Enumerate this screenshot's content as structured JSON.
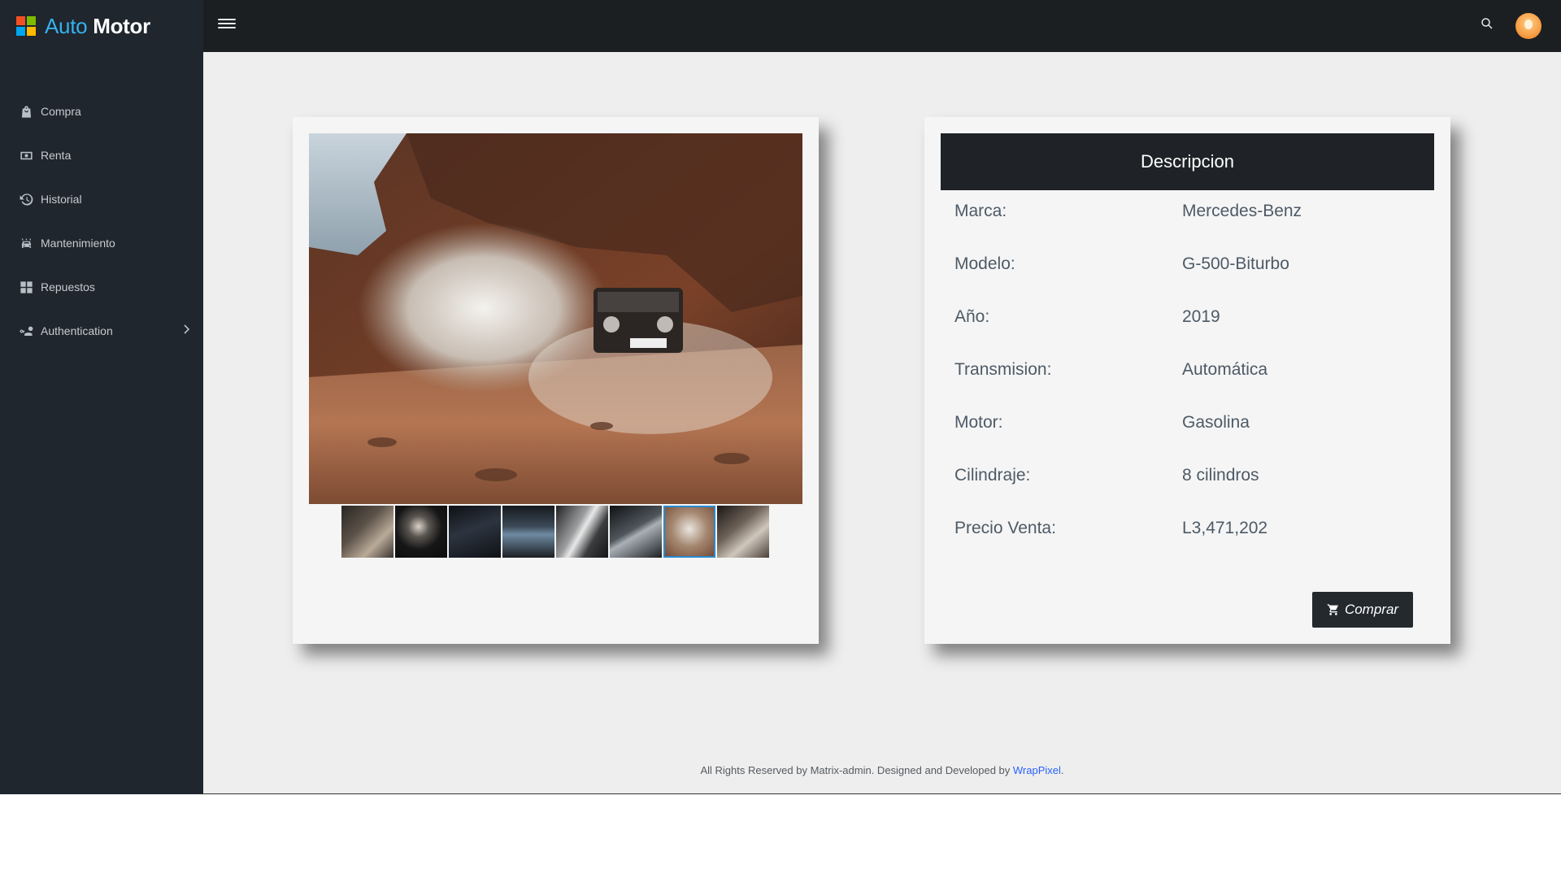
{
  "brand": {
    "name_auto": "Auto",
    "name_motor": "Motor",
    "logo_colors": [
      "#f25022",
      "#7fba00",
      "#00a4ef",
      "#ffb900"
    ]
  },
  "sidebar": {
    "items": [
      {
        "label": "Compra",
        "icon": "shopping-bag-icon"
      },
      {
        "label": "Renta",
        "icon": "cash-icon"
      },
      {
        "label": "Historial",
        "icon": "history-icon"
      },
      {
        "label": "Mantenimiento",
        "icon": "car-wash-icon"
      },
      {
        "label": "Repuestos",
        "icon": "grid-icon"
      },
      {
        "label": "Authentication",
        "icon": "account-key-icon",
        "has_submenu": true
      }
    ]
  },
  "topbar": {
    "menu_icon": "hamburger-icon",
    "search_icon": "search-icon",
    "avatar_icon": "avatar"
  },
  "gallery": {
    "thumbnail_count": 8,
    "active_thumbnail": 7
  },
  "description": {
    "title": "Descripcion",
    "specs": [
      {
        "label": "Marca:",
        "value": "Mercedes-Benz"
      },
      {
        "label": "Modelo:",
        "value": "G-500-Biturbo"
      },
      {
        "label": "Año:",
        "value": "2019"
      },
      {
        "label": "Transmision:",
        "value": "Automática"
      },
      {
        "label": "Motor:",
        "value": "Gasolina"
      },
      {
        "label": "Cilindraje:",
        "value": "8 cilindros"
      },
      {
        "label": "Precio Venta:",
        "value": "L3,471,202"
      }
    ],
    "buy_label": "Comprar"
  },
  "footer": {
    "text": "All Rights Reserved by Matrix-admin. Designed and Developed by ",
    "link_text": "WrapPixel",
    "suffix": "."
  },
  "colors": {
    "sidebar_bg": "#1f262d",
    "topbar_bg": "#1c1f22",
    "content_bg": "#eeeeee",
    "accent_link": "#2962ff",
    "active_thumb_border": "#2a89d0"
  }
}
